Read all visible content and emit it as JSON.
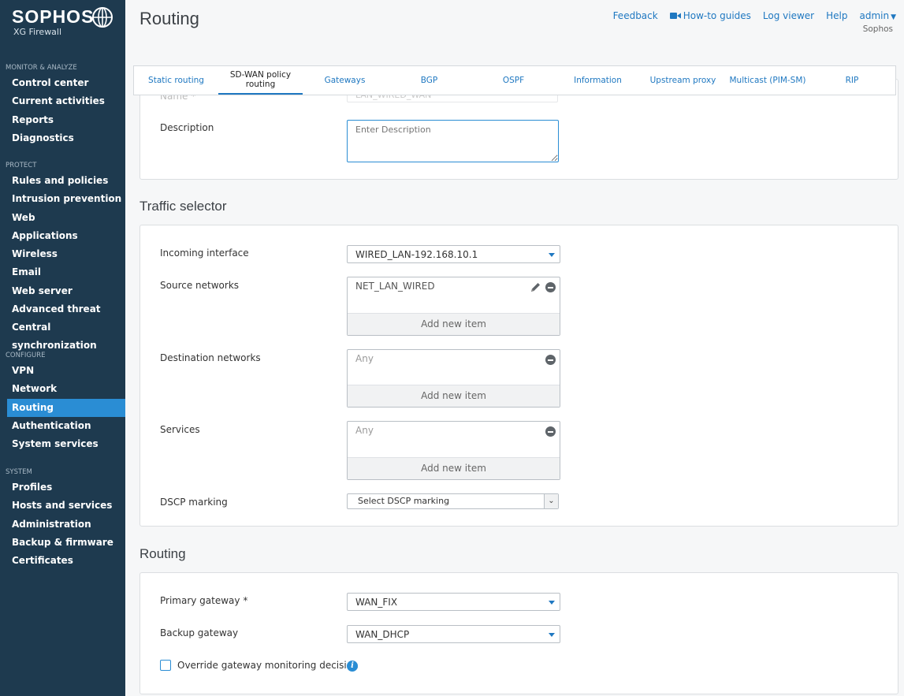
{
  "brand": {
    "name": "SOPHOS",
    "product": "XG Firewall"
  },
  "sidebar": {
    "groups": [
      {
        "header": "MONITOR & ANALYZE",
        "items": [
          "Control center",
          "Current activities",
          "Reports",
          "Diagnostics"
        ]
      },
      {
        "header": "PROTECT",
        "items": [
          "Rules and policies",
          "Intrusion prevention",
          "Web",
          "Applications",
          "Wireless",
          "Email",
          "Web server",
          "Advanced threat",
          "Central synchronization"
        ]
      },
      {
        "header": "CONFIGURE",
        "items": [
          "VPN",
          "Network",
          "Routing",
          "Authentication",
          "System services"
        ]
      },
      {
        "header": "SYSTEM",
        "items": [
          "Profiles",
          "Hosts and services",
          "Administration",
          "Backup & firmware",
          "Certificates"
        ]
      }
    ],
    "active": "Routing"
  },
  "header": {
    "title": "Routing",
    "links": {
      "feedback": "Feedback",
      "howto": "How-to guides",
      "logviewer": "Log viewer",
      "help": "Help",
      "user": "admin"
    },
    "tenant": "Sophos"
  },
  "tabs": [
    {
      "label": "Static routing"
    },
    {
      "label": "SD-WAN policy routing",
      "active": true
    },
    {
      "label": "Gateways"
    },
    {
      "label": "BGP"
    },
    {
      "label": "OSPF"
    },
    {
      "label": "Information"
    },
    {
      "label": "Upstream proxy"
    },
    {
      "label": "Multicast (PIM-SM)"
    },
    {
      "label": "RIP"
    }
  ],
  "general": {
    "name_label": "Name *",
    "name_value": "LAN_WIRED_WAN",
    "description_label": "Description",
    "description_placeholder": "Enter Description"
  },
  "traffic_selector": {
    "title": "Traffic selector",
    "incoming_label": "Incoming interface",
    "incoming_value": "WIRED_LAN-192.168.10.1",
    "source_label": "Source networks",
    "source_items": [
      "NET_LAN_WIRED"
    ],
    "destination_label": "Destination networks",
    "destination_items": [
      "Any"
    ],
    "services_label": "Services",
    "services_items": [
      "Any"
    ],
    "add_new": "Add new item",
    "dscp_label": "DSCP marking",
    "dscp_value": "Select DSCP marking"
  },
  "routing": {
    "title": "Routing",
    "primary_label": "Primary gateway *",
    "primary_value": "WAN_FIX",
    "backup_label": "Backup gateway",
    "backup_value": "WAN_DHCP",
    "override_label": "Override gateway monitoring decision",
    "override_checked": false
  },
  "colors": {
    "sidebar": "#1e3a4f",
    "accent": "#2a8dd4",
    "link": "#1f78c1"
  }
}
